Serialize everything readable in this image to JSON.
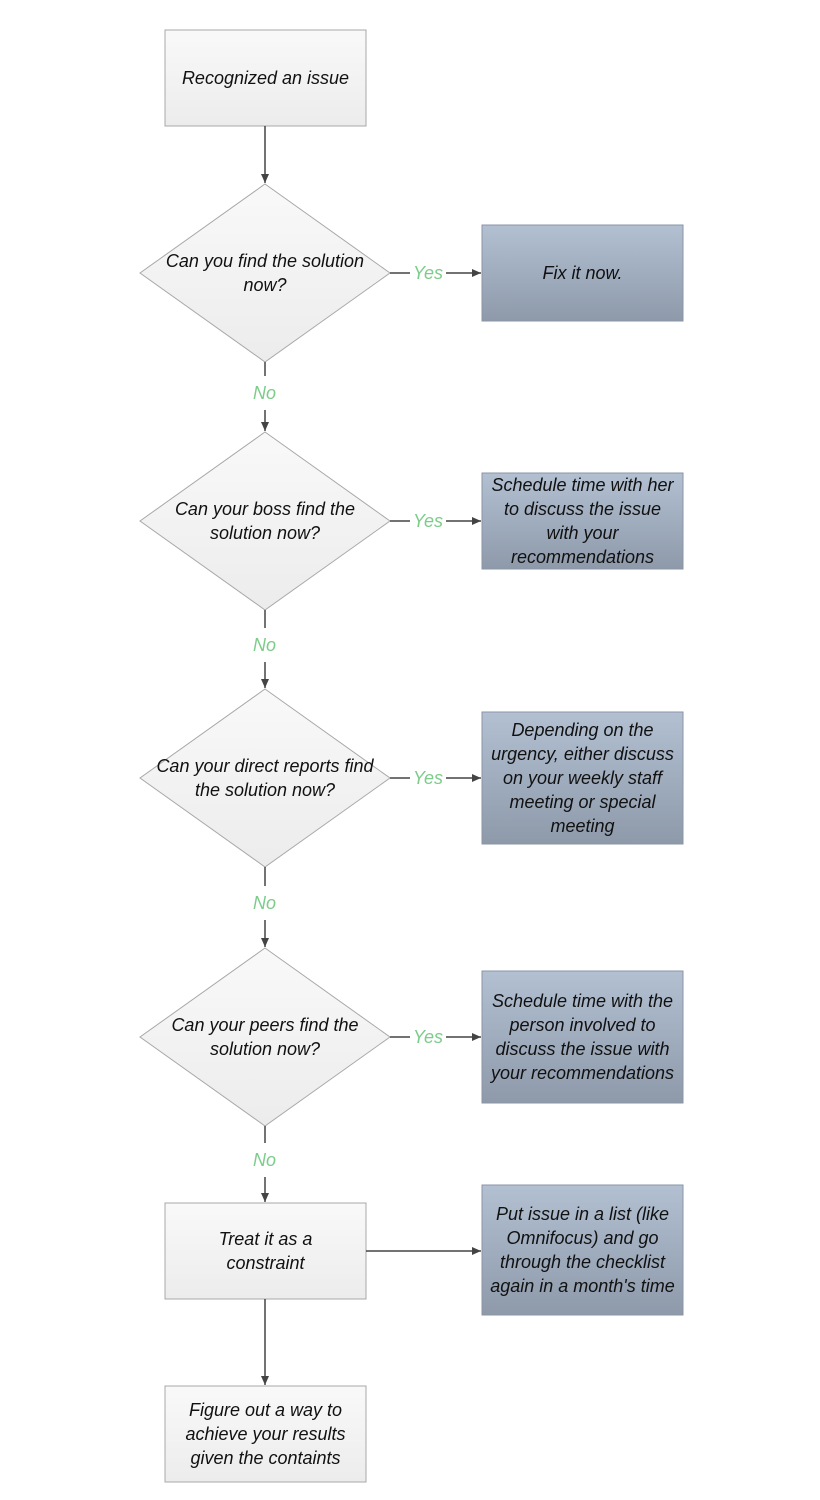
{
  "diagram": {
    "colors": {
      "start_fill_top": "#f9f9f9",
      "start_fill_bottom": "#ececec",
      "outcome_fill_top": "#b2c0d2",
      "outcome_fill_bottom": "#8e9aaa",
      "stroke": "#a8a8a8",
      "connector": "#444444",
      "label": "#7ccc8a"
    },
    "nodes": {
      "start": "Recognized an issue",
      "decision1": "Can you find the solution now?",
      "outcome1": "Fix it now.",
      "decision2": "Can your boss find the solution now?",
      "outcome2": "Schedule time with her to discuss the issue with your recommendations",
      "decision3": "Can your direct reports find the solution now?",
      "outcome3": "Depending on the urgency, either discuss on your weekly staff meeting or special meeting",
      "decision4": "Can your peers find the solution now?",
      "outcome4": "Schedule time with the person involved to discuss the issue with your recommendations",
      "constraint": "Treat it as a constraint",
      "outcome5": "Put issue in a list (like Omnifocus) and go through the checklist again in a month's time",
      "final": "Figure out a way to achieve your results given the containts"
    },
    "labels": {
      "yes": "Yes",
      "no": "No"
    }
  }
}
